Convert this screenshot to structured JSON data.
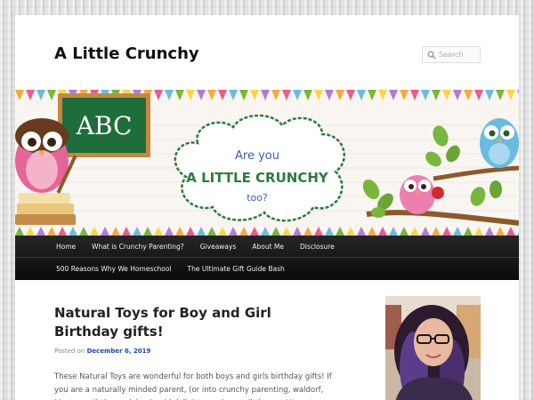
{
  "site": {
    "title": "A Little Crunchy"
  },
  "search": {
    "placeholder": "Search"
  },
  "banner": {
    "chalkboard_text": "ABC",
    "line1": "Are you",
    "line2": "A LITTLE CRUNCHY",
    "line3": "too?"
  },
  "nav": {
    "row1": [
      "Home",
      "What is Crunchy Parenting?",
      "Giveaways",
      "About Me",
      "Disclosure"
    ],
    "row2": [
      "500 Reasons Why We Homeschool",
      "The Ultimate Gift Guide Bash"
    ]
  },
  "post": {
    "title": "Natural Toys for Boy and Girl Birthday gifts!",
    "meta_prefix": "Posted on",
    "date": "December 6, 2019",
    "body": "These Natural Toys are wonderful for both boys and girls birthday gifts! If you are a naturally minded parent, (or into crunchy parenting, waldorf, Montessori) these picks should delight your boy or little one. We got"
  },
  "colors": {
    "nav_background": "#1a1a1a",
    "link_blue": "#1b44b8",
    "chalkboard_green": "#1f6d3a",
    "banner_text_green": "#2d7b3f"
  },
  "icons": {
    "search": "search-icon"
  }
}
